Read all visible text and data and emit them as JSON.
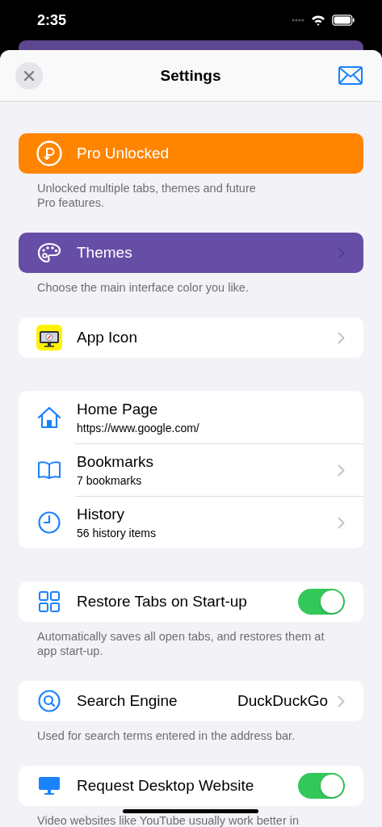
{
  "status_bar": {
    "time": "2:35"
  },
  "header": {
    "title": "Settings"
  },
  "sections": [
    {
      "color": "#ff8500",
      "rows": [
        {
          "kind": "plain",
          "label": "Pro Unlocked"
        }
      ],
      "footer": "Unlocked multiple tabs, themes and future\nPro features."
    },
    {
      "color": "#664ea6",
      "rows": [
        {
          "kind": "link",
          "label": "Themes"
        }
      ],
      "footer": "Choose the main interface color you like."
    },
    {
      "rows": [
        {
          "kind": "link",
          "label": "App Icon"
        }
      ]
    },
    {
      "rows": [
        {
          "kind": "plain",
          "label": "Home Page",
          "detail": "https://www.google.com/"
        },
        {
          "kind": "link",
          "label": "Bookmarks",
          "detail": "7 bookmarks"
        },
        {
          "kind": "link",
          "label": "History",
          "detail": "56 history items"
        }
      ]
    },
    {
      "rows": [
        {
          "kind": "toggle",
          "label": "Restore Tabs on Start-up",
          "on": true
        }
      ],
      "footer": "Automatically saves all open tabs, and restores them at app start-up."
    },
    {
      "rows": [
        {
          "kind": "value",
          "label": "Search Engine",
          "value": "DuckDuckGo"
        }
      ],
      "footer": "Used for search terms entered in the address bar."
    },
    {
      "rows": [
        {
          "kind": "toggle",
          "label": "Request Desktop Website",
          "on": true
        }
      ],
      "footer": "Video websites like YouTube usually work better in"
    }
  ]
}
